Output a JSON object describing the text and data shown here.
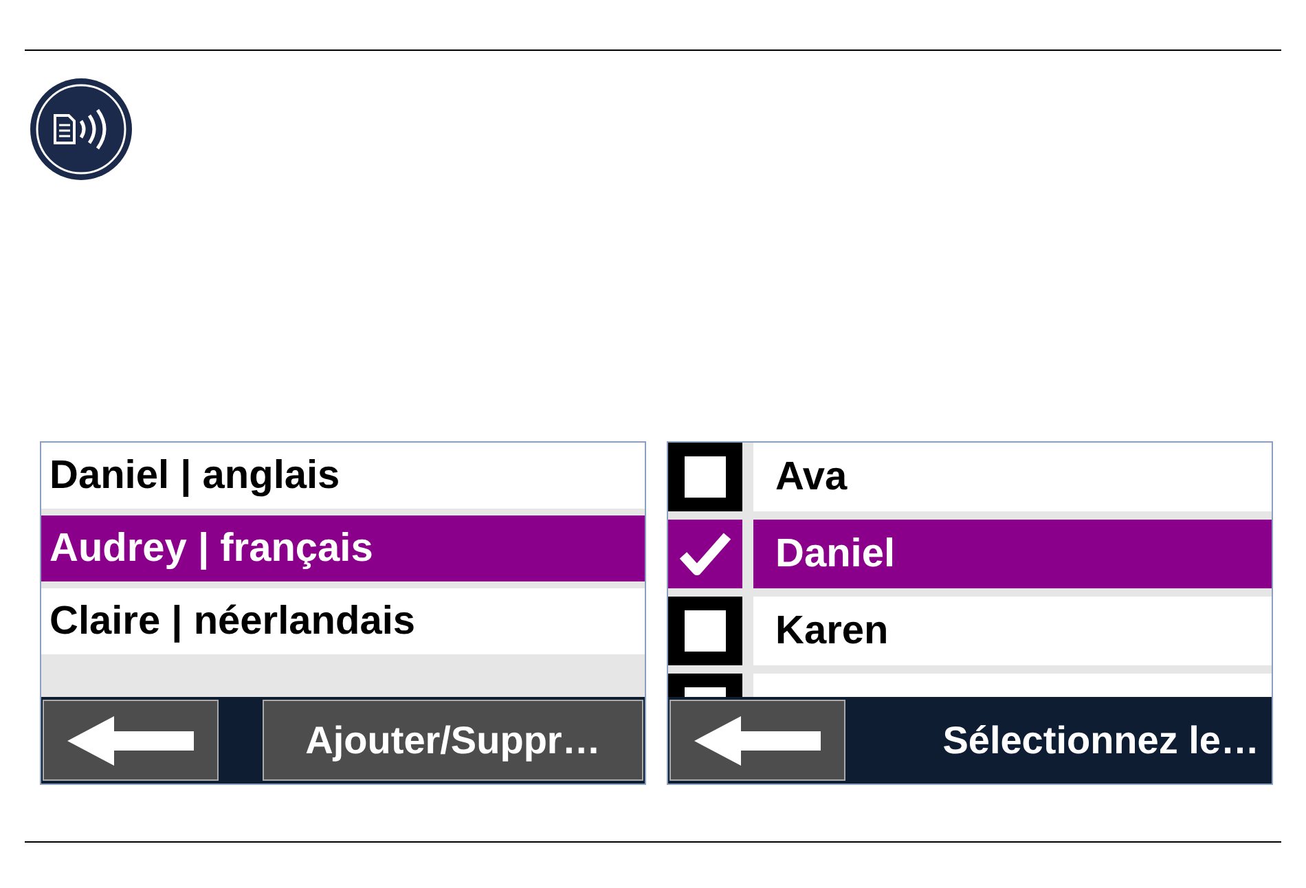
{
  "voices_panel": {
    "items": [
      {
        "label": "Daniel | anglais",
        "selected": false
      },
      {
        "label": "Audrey | français",
        "selected": true
      },
      {
        "label": "Claire | néerlandais",
        "selected": false
      }
    ],
    "action_button": "Ajouter/Suppr…"
  },
  "select_panel": {
    "items": [
      {
        "label": "Ava",
        "checked": false,
        "selected": false
      },
      {
        "label": "Daniel",
        "checked": true,
        "selected": true
      },
      {
        "label": "Karen",
        "checked": false,
        "selected": false
      },
      {
        "checked": false,
        "selected": false
      }
    ],
    "title": "Sélectionnez le…"
  }
}
